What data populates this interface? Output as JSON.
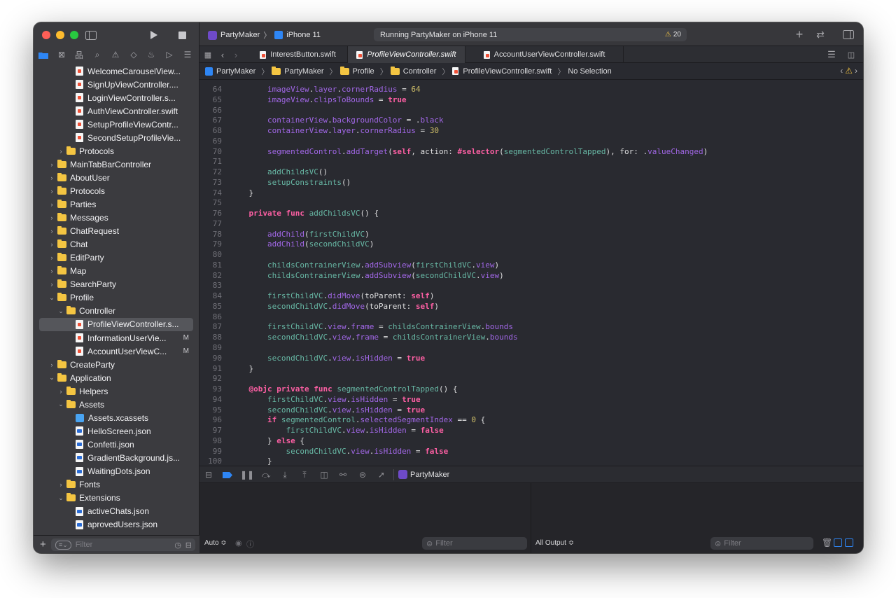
{
  "toolbar": {
    "scheme": "PartyMaker",
    "device": "iPhone 11",
    "status": "Running PartyMaker on iPhone 11",
    "warning_count": "20"
  },
  "navigator": {
    "items": [
      {
        "label": "WelcomeCarouselView...",
        "type": "swift",
        "indent": 2,
        "chevron": "",
        "badge": ""
      },
      {
        "label": "SignUpViewController....",
        "type": "swift",
        "indent": 2,
        "chevron": "",
        "badge": ""
      },
      {
        "label": "LoginViewController.s...",
        "type": "swift",
        "indent": 2,
        "chevron": "",
        "badge": ""
      },
      {
        "label": "AuthViewController.swift",
        "type": "swift",
        "indent": 2,
        "chevron": "",
        "badge": ""
      },
      {
        "label": "SetupProfileViewContr...",
        "type": "swift",
        "indent": 2,
        "chevron": "",
        "badge": ""
      },
      {
        "label": "SecondSetupProfileVie...",
        "type": "swift",
        "indent": 2,
        "chevron": "",
        "badge": ""
      },
      {
        "label": "Protocols",
        "type": "folder",
        "indent": 1,
        "chevron": "›",
        "badge": ""
      },
      {
        "label": "MainTabBarController",
        "type": "folder",
        "indent": 0,
        "chevron": "›",
        "badge": ""
      },
      {
        "label": "AboutUser",
        "type": "folder",
        "indent": 0,
        "chevron": "›",
        "badge": ""
      },
      {
        "label": "Protocols",
        "type": "folder",
        "indent": 0,
        "chevron": "›",
        "badge": ""
      },
      {
        "label": "Parties",
        "type": "folder",
        "indent": 0,
        "chevron": "›",
        "badge": ""
      },
      {
        "label": "Messages",
        "type": "folder",
        "indent": 0,
        "chevron": "›",
        "badge": ""
      },
      {
        "label": "ChatRequest",
        "type": "folder",
        "indent": 0,
        "chevron": "›",
        "badge": ""
      },
      {
        "label": "Chat",
        "type": "folder",
        "indent": 0,
        "chevron": "›",
        "badge": ""
      },
      {
        "label": "EditParty",
        "type": "folder",
        "indent": 0,
        "chevron": "›",
        "badge": ""
      },
      {
        "label": "Map",
        "type": "folder",
        "indent": 0,
        "chevron": "›",
        "badge": ""
      },
      {
        "label": "SearchParty",
        "type": "folder",
        "indent": 0,
        "chevron": "›",
        "badge": ""
      },
      {
        "label": "Profile",
        "type": "folder",
        "indent": 0,
        "chevron": "⌄",
        "badge": ""
      },
      {
        "label": "Controller",
        "type": "folder",
        "indent": 1,
        "chevron": "⌄",
        "badge": ""
      },
      {
        "label": "ProfileViewController.s...",
        "type": "swift",
        "indent": 2,
        "chevron": "",
        "badge": "",
        "selected": true
      },
      {
        "label": "InformationUserVie...",
        "type": "swift",
        "indent": 2,
        "chevron": "",
        "badge": "M"
      },
      {
        "label": "AccountUserViewC...",
        "type": "swift",
        "indent": 2,
        "chevron": "",
        "badge": "M"
      },
      {
        "label": "CreateParty",
        "type": "folder",
        "indent": 0,
        "chevron": "›",
        "badge": ""
      },
      {
        "label": "Application",
        "type": "folder",
        "indent": 0,
        "chevron": "⌄",
        "badge": ""
      },
      {
        "label": "Helpers",
        "type": "folder",
        "indent": 1,
        "chevron": "›",
        "badge": ""
      },
      {
        "label": "Assets",
        "type": "folder",
        "indent": 1,
        "chevron": "⌄",
        "badge": ""
      },
      {
        "label": "Assets.xcassets",
        "type": "assets",
        "indent": 2,
        "chevron": "",
        "badge": ""
      },
      {
        "label": "HelloScreen.json",
        "type": "json",
        "indent": 2,
        "chevron": "",
        "badge": ""
      },
      {
        "label": "Confetti.json",
        "type": "json",
        "indent": 2,
        "chevron": "",
        "badge": ""
      },
      {
        "label": "GradientBackground.js...",
        "type": "json",
        "indent": 2,
        "chevron": "",
        "badge": ""
      },
      {
        "label": "WaitingDots.json",
        "type": "json",
        "indent": 2,
        "chevron": "",
        "badge": ""
      },
      {
        "label": "Fonts",
        "type": "folder",
        "indent": 1,
        "chevron": "›",
        "badge": ""
      },
      {
        "label": "Extensions",
        "type": "folder",
        "indent": 1,
        "chevron": "⌄",
        "badge": ""
      },
      {
        "label": "activeChats.json",
        "type": "json",
        "indent": 2,
        "chevron": "",
        "badge": ""
      },
      {
        "label": "aprovedUsers.json",
        "type": "json",
        "indent": 2,
        "chevron": "",
        "badge": ""
      }
    ],
    "filter_placeholder": "Filter"
  },
  "tabs": [
    {
      "label": "InterestButton.swift",
      "active": false
    },
    {
      "label": "ProfileViewController.swift",
      "active": true
    },
    {
      "label": "AccountUserViewController.swift",
      "active": false
    }
  ],
  "breadcrumb": [
    "PartyMaker",
    "PartyMaker",
    "Profile",
    "Controller",
    "ProfileViewController.swift",
    "No Selection"
  ],
  "code": [
    {
      "n": "64",
      "t": [
        [
          "tx",
          "        "
        ],
        [
          "id",
          "imageView"
        ],
        [
          "tx",
          "."
        ],
        [
          "id",
          "layer"
        ],
        [
          "tx",
          "."
        ],
        [
          "id",
          "cornerRadius"
        ],
        [
          "tx",
          " = "
        ],
        [
          "num",
          "64"
        ]
      ]
    },
    {
      "n": "65",
      "t": [
        [
          "tx",
          "        "
        ],
        [
          "id",
          "imageView"
        ],
        [
          "tx",
          "."
        ],
        [
          "id",
          "clipsToBounds"
        ],
        [
          "tx",
          " = "
        ],
        [
          "kw",
          "true"
        ]
      ]
    },
    {
      "n": "66",
      "t": []
    },
    {
      "n": "67",
      "t": [
        [
          "tx",
          "        "
        ],
        [
          "id",
          "containerView"
        ],
        [
          "tx",
          "."
        ],
        [
          "id",
          "backgroundColor"
        ],
        [
          "tx",
          " = ."
        ],
        [
          "id",
          "black"
        ]
      ]
    },
    {
      "n": "68",
      "t": [
        [
          "tx",
          "        "
        ],
        [
          "id",
          "containerView"
        ],
        [
          "tx",
          "."
        ],
        [
          "id",
          "layer"
        ],
        [
          "tx",
          "."
        ],
        [
          "id",
          "cornerRadius"
        ],
        [
          "tx",
          " = "
        ],
        [
          "num",
          "30"
        ]
      ]
    },
    {
      "n": "69",
      "t": []
    },
    {
      "n": "70",
      "t": [
        [
          "tx",
          "        "
        ],
        [
          "id",
          "segmentedControl"
        ],
        [
          "tx",
          "."
        ],
        [
          "id",
          "addTarget"
        ],
        [
          "tx",
          "("
        ],
        [
          "kw",
          "self"
        ],
        [
          "tx",
          ", action: "
        ],
        [
          "kw",
          "#selector"
        ],
        [
          "tx",
          "("
        ],
        [
          "fn",
          "segmentedControlTapped"
        ],
        [
          "tx",
          "), for: ."
        ],
        [
          "id",
          "valueChanged"
        ],
        [
          "tx",
          ")"
        ]
      ]
    },
    {
      "n": "71",
      "t": []
    },
    {
      "n": "72",
      "t": [
        [
          "tx",
          "        "
        ],
        [
          "fn",
          "addChildsVC"
        ],
        [
          "tx",
          "()"
        ]
      ]
    },
    {
      "n": "73",
      "t": [
        [
          "tx",
          "        "
        ],
        [
          "fn",
          "setupConstraints"
        ],
        [
          "tx",
          "()"
        ]
      ]
    },
    {
      "n": "74",
      "t": [
        [
          "tx",
          "    }"
        ]
      ]
    },
    {
      "n": "75",
      "t": []
    },
    {
      "n": "76",
      "t": [
        [
          "tx",
          "    "
        ],
        [
          "kw",
          "private func"
        ],
        [
          "tx",
          " "
        ],
        [
          "fn",
          "addChildsVC"
        ],
        [
          "tx",
          "() {"
        ]
      ]
    },
    {
      "n": "77",
      "t": []
    },
    {
      "n": "78",
      "t": [
        [
          "tx",
          "        "
        ],
        [
          "id",
          "addChild"
        ],
        [
          "tx",
          "("
        ],
        [
          "fn",
          "firstChildVC"
        ],
        [
          "tx",
          ")"
        ]
      ]
    },
    {
      "n": "79",
      "t": [
        [
          "tx",
          "        "
        ],
        [
          "id",
          "addChild"
        ],
        [
          "tx",
          "("
        ],
        [
          "fn",
          "secondChildVC"
        ],
        [
          "tx",
          ")"
        ]
      ]
    },
    {
      "n": "80",
      "t": []
    },
    {
      "n": "81",
      "t": [
        [
          "tx",
          "        "
        ],
        [
          "fn",
          "childsContrainerView"
        ],
        [
          "tx",
          "."
        ],
        [
          "id",
          "addSubview"
        ],
        [
          "tx",
          "("
        ],
        [
          "fn",
          "firstChildVC"
        ],
        [
          "tx",
          "."
        ],
        [
          "id",
          "view"
        ],
        [
          "tx",
          ")"
        ]
      ]
    },
    {
      "n": "82",
      "t": [
        [
          "tx",
          "        "
        ],
        [
          "fn",
          "childsContrainerView"
        ],
        [
          "tx",
          "."
        ],
        [
          "id",
          "addSubview"
        ],
        [
          "tx",
          "("
        ],
        [
          "fn",
          "secondChildVC"
        ],
        [
          "tx",
          "."
        ],
        [
          "id",
          "view"
        ],
        [
          "tx",
          ")"
        ]
      ]
    },
    {
      "n": "83",
      "t": []
    },
    {
      "n": "84",
      "t": [
        [
          "tx",
          "        "
        ],
        [
          "fn",
          "firstChildVC"
        ],
        [
          "tx",
          "."
        ],
        [
          "id",
          "didMove"
        ],
        [
          "tx",
          "(toParent: "
        ],
        [
          "kw",
          "self"
        ],
        [
          "tx",
          ")"
        ]
      ]
    },
    {
      "n": "85",
      "t": [
        [
          "tx",
          "        "
        ],
        [
          "fn",
          "secondChildVC"
        ],
        [
          "tx",
          "."
        ],
        [
          "id",
          "didMove"
        ],
        [
          "tx",
          "(toParent: "
        ],
        [
          "kw",
          "self"
        ],
        [
          "tx",
          ")"
        ]
      ]
    },
    {
      "n": "86",
      "t": []
    },
    {
      "n": "87",
      "t": [
        [
          "tx",
          "        "
        ],
        [
          "fn",
          "firstChildVC"
        ],
        [
          "tx",
          "."
        ],
        [
          "id",
          "view"
        ],
        [
          "tx",
          "."
        ],
        [
          "id",
          "frame"
        ],
        [
          "tx",
          " = "
        ],
        [
          "fn",
          "childsContrainerView"
        ],
        [
          "tx",
          "."
        ],
        [
          "id",
          "bounds"
        ]
      ]
    },
    {
      "n": "88",
      "t": [
        [
          "tx",
          "        "
        ],
        [
          "fn",
          "secondChildVC"
        ],
        [
          "tx",
          "."
        ],
        [
          "id",
          "view"
        ],
        [
          "tx",
          "."
        ],
        [
          "id",
          "frame"
        ],
        [
          "tx",
          " = "
        ],
        [
          "fn",
          "childsContrainerView"
        ],
        [
          "tx",
          "."
        ],
        [
          "id",
          "bounds"
        ]
      ]
    },
    {
      "n": "89",
      "t": []
    },
    {
      "n": "90",
      "t": [
        [
          "tx",
          "        "
        ],
        [
          "fn",
          "secondChildVC"
        ],
        [
          "tx",
          "."
        ],
        [
          "id",
          "view"
        ],
        [
          "tx",
          "."
        ],
        [
          "id",
          "isHidden"
        ],
        [
          "tx",
          " = "
        ],
        [
          "kw",
          "true"
        ]
      ]
    },
    {
      "n": "91",
      "t": [
        [
          "tx",
          "    }"
        ]
      ]
    },
    {
      "n": "92",
      "t": []
    },
    {
      "n": "93",
      "t": [
        [
          "tx",
          "    "
        ],
        [
          "kw",
          "@objc private func"
        ],
        [
          "tx",
          " "
        ],
        [
          "fn",
          "segmentedControlTapped"
        ],
        [
          "tx",
          "() {"
        ]
      ]
    },
    {
      "n": "94",
      "t": [
        [
          "tx",
          "        "
        ],
        [
          "fn",
          "firstChildVC"
        ],
        [
          "tx",
          "."
        ],
        [
          "id",
          "view"
        ],
        [
          "tx",
          "."
        ],
        [
          "id",
          "isHidden"
        ],
        [
          "tx",
          " = "
        ],
        [
          "kw",
          "true"
        ]
      ]
    },
    {
      "n": "95",
      "t": [
        [
          "tx",
          "        "
        ],
        [
          "fn",
          "secondChildVC"
        ],
        [
          "tx",
          "."
        ],
        [
          "id",
          "view"
        ],
        [
          "tx",
          "."
        ],
        [
          "id",
          "isHidden"
        ],
        [
          "tx",
          " = "
        ],
        [
          "kw",
          "true"
        ]
      ]
    },
    {
      "n": "96",
      "t": [
        [
          "tx",
          "        "
        ],
        [
          "kw",
          "if"
        ],
        [
          "tx",
          " "
        ],
        [
          "fn",
          "segmentedControl"
        ],
        [
          "tx",
          "."
        ],
        [
          "id",
          "selectedSegmentIndex"
        ],
        [
          "tx",
          " == "
        ],
        [
          "num",
          "0"
        ],
        [
          "tx",
          " {"
        ]
      ]
    },
    {
      "n": "97",
      "t": [
        [
          "tx",
          "            "
        ],
        [
          "fn",
          "firstChildVC"
        ],
        [
          "tx",
          "."
        ],
        [
          "id",
          "view"
        ],
        [
          "tx",
          "."
        ],
        [
          "id",
          "isHidden"
        ],
        [
          "tx",
          " = "
        ],
        [
          "kw",
          "false"
        ]
      ]
    },
    {
      "n": "98",
      "t": [
        [
          "tx",
          "        } "
        ],
        [
          "kw",
          "else"
        ],
        [
          "tx",
          " {"
        ]
      ]
    },
    {
      "n": "99",
      "t": [
        [
          "tx",
          "            "
        ],
        [
          "fn",
          "secondChildVC"
        ],
        [
          "tx",
          "."
        ],
        [
          "id",
          "view"
        ],
        [
          "tx",
          "."
        ],
        [
          "id",
          "isHidden"
        ],
        [
          "tx",
          " = "
        ],
        [
          "kw",
          "false"
        ]
      ]
    },
    {
      "n": "100",
      "t": [
        [
          "tx",
          "        }"
        ]
      ]
    }
  ],
  "debug": {
    "target": "PartyMaker",
    "auto_label": "Auto ≎",
    "filter_placeholder": "Filter",
    "output_label": "All Output ≎"
  }
}
